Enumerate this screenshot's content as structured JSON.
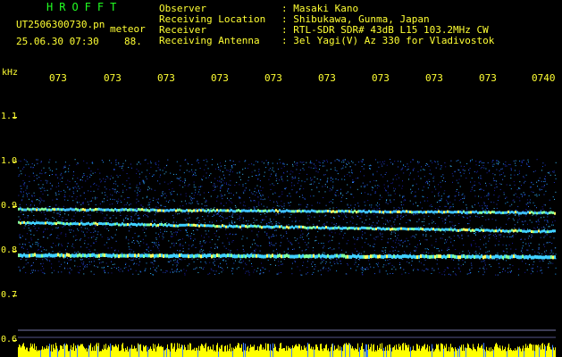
{
  "header": {
    "app_name": "HROFFT",
    "file_name": "UT2506300730.pn",
    "mode": "meteor",
    "datetime": "25.06.30 07:30",
    "count": "88."
  },
  "info": [
    {
      "key": "Observer",
      "sep": ": ",
      "value": "Masaki Kano"
    },
    {
      "key": "Receiving Location",
      "sep": ": ",
      "value": "Shibukawa, Gunma, Japan"
    },
    {
      "key": "Receiver",
      "sep": ": ",
      "value": "RTL-SDR SDR# 43dB L15 103.2MHz CW"
    },
    {
      "key": "Receiving Antenna",
      "sep": ": ",
      "value": "3el Yagi(V) Az 330 for Vladivostok"
    }
  ],
  "axes": {
    "y_unit": "kHz",
    "x_ticks": [
      "073",
      "073",
      "073",
      "073",
      "073",
      "073",
      "073",
      "073",
      "073",
      "0740"
    ],
    "y_ticks": [
      "1.1",
      "1.0",
      "0.9",
      "0.8",
      "0.7",
      "0.6"
    ]
  },
  "colors": {
    "text": "#ffff33",
    "title": "#22ff22",
    "background": "#000000",
    "activity": "#ffff00"
  }
}
